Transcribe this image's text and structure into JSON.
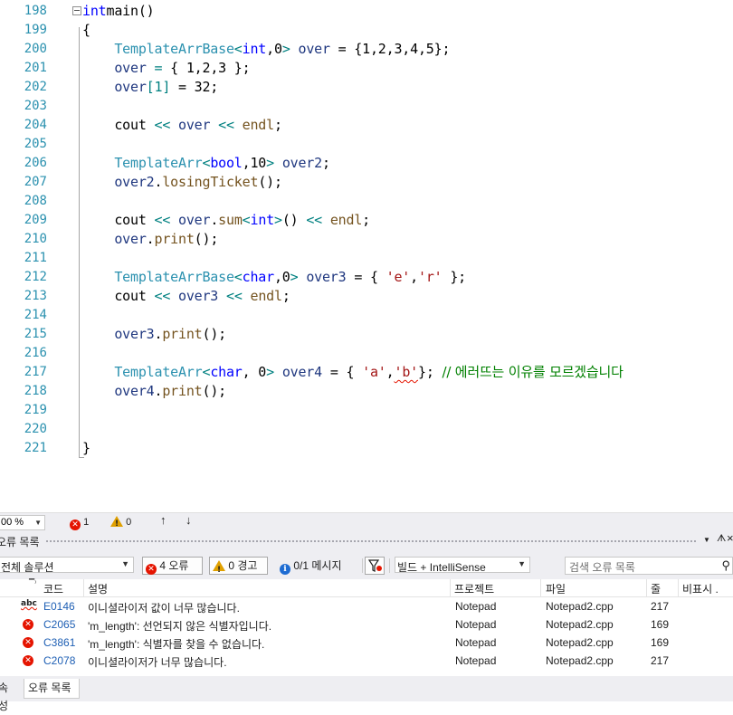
{
  "editor": {
    "lines": [
      {
        "num": "198",
        "tokens": [
          [
            "kw",
            "int"
          ],
          [
            "",
            "main()"
          ]
        ]
      },
      {
        "num": "199",
        "tokens": [
          [
            "",
            "{"
          ]
        ]
      },
      {
        "num": "200",
        "tokens": [
          [
            "",
            "    "
          ],
          [
            "ty",
            "TemplateArrBase"
          ],
          [
            "op",
            "<"
          ],
          [
            "kw",
            "int"
          ],
          [
            "",
            ",0"
          ],
          [
            "op",
            ">"
          ],
          [
            "",
            ""
          ],
          [
            "var",
            " over"
          ],
          [
            "",
            " = {1,2,3,4,5};"
          ]
        ]
      },
      {
        "num": "201",
        "tokens": [
          [
            "",
            "    "
          ],
          [
            "var",
            "over"
          ],
          [
            "op",
            " ="
          ],
          [
            "",
            " { 1,2,3 };"
          ]
        ]
      },
      {
        "num": "202",
        "tokens": [
          [
            "",
            "    "
          ],
          [
            "var",
            "over"
          ],
          [
            "op",
            "[1]"
          ],
          [
            "",
            " = 32;"
          ]
        ]
      },
      {
        "num": "203",
        "tokens": []
      },
      {
        "num": "204",
        "tokens": [
          [
            "",
            "    cout "
          ],
          [
            "op",
            "<<"
          ],
          [
            "var",
            " over"
          ],
          [
            "op",
            " <<"
          ],
          [
            "fn",
            " endl"
          ],
          [
            "",
            ";"
          ]
        ]
      },
      {
        "num": "205",
        "tokens": []
      },
      {
        "num": "206",
        "tokens": [
          [
            "",
            "    "
          ],
          [
            "ty",
            "TemplateArr"
          ],
          [
            "op",
            "<"
          ],
          [
            "kw",
            "bool"
          ],
          [
            "",
            ",10"
          ],
          [
            "op",
            ">"
          ],
          [
            "var",
            " over2"
          ],
          [
            "",
            ";"
          ]
        ]
      },
      {
        "num": "207",
        "tokens": [
          [
            "",
            "    "
          ],
          [
            "var",
            "over2"
          ],
          [
            "",
            "."
          ],
          [
            "fn",
            "losingTicket"
          ],
          [
            "",
            "();"
          ]
        ]
      },
      {
        "num": "208",
        "tokens": []
      },
      {
        "num": "209",
        "tokens": [
          [
            "",
            "    cout "
          ],
          [
            "op",
            "<<"
          ],
          [
            "var",
            " over"
          ],
          [
            "",
            "."
          ],
          [
            "fn",
            "sum"
          ],
          [
            "op",
            "<"
          ],
          [
            "kw",
            "int"
          ],
          [
            "op",
            ">"
          ],
          [
            "",
            "() "
          ],
          [
            "op",
            "<<"
          ],
          [
            "fn",
            " endl"
          ],
          [
            "",
            ";"
          ]
        ]
      },
      {
        "num": "210",
        "tokens": [
          [
            "",
            "    "
          ],
          [
            "var",
            "over"
          ],
          [
            "",
            "."
          ],
          [
            "fn",
            "print"
          ],
          [
            "",
            "();"
          ]
        ]
      },
      {
        "num": "211",
        "tokens": []
      },
      {
        "num": "212",
        "tokens": [
          [
            "",
            "    "
          ],
          [
            "ty",
            "TemplateArrBase"
          ],
          [
            "op",
            "<"
          ],
          [
            "kw",
            "char"
          ],
          [
            "",
            ",0"
          ],
          [
            "op",
            ">"
          ],
          [
            "var",
            " over3"
          ],
          [
            "",
            " = { "
          ],
          [
            "str",
            "'e'"
          ],
          [
            "",
            ","
          ],
          [
            "str",
            "'r'"
          ],
          [
            "",
            " };"
          ]
        ]
      },
      {
        "num": "213",
        "tokens": [
          [
            "",
            "    cout "
          ],
          [
            "op",
            "<<"
          ],
          [
            "var",
            " over3"
          ],
          [
            "op",
            " <<"
          ],
          [
            "fn",
            " endl"
          ],
          [
            "",
            ";"
          ]
        ]
      },
      {
        "num": "214",
        "tokens": []
      },
      {
        "num": "215",
        "tokens": [
          [
            "",
            "    "
          ],
          [
            "var",
            "over3"
          ],
          [
            "",
            "."
          ],
          [
            "fn",
            "print"
          ],
          [
            "",
            "();"
          ]
        ]
      },
      {
        "num": "216",
        "tokens": []
      },
      {
        "num": "217",
        "tokens": [
          [
            "",
            "    "
          ],
          [
            "ty",
            "TemplateArr"
          ],
          [
            "op",
            "<"
          ],
          [
            "kw",
            "char"
          ],
          [
            "",
            ", 0"
          ],
          [
            "op",
            ">"
          ],
          [
            "var",
            " over4"
          ],
          [
            "",
            " = { "
          ],
          [
            "str",
            "'a'"
          ],
          [
            "",
            ","
          ],
          [
            "str squig",
            "'b'"
          ],
          [
            "",
            "}; "
          ],
          [
            "cm",
            "// 에러뜨는 이유를 모르겠습니다"
          ]
        ]
      },
      {
        "num": "218",
        "tokens": [
          [
            "",
            "    "
          ],
          [
            "var",
            "over4"
          ],
          [
            "",
            "."
          ],
          [
            "fn",
            "print"
          ],
          [
            "",
            "();"
          ]
        ]
      },
      {
        "num": "219",
        "tokens": []
      },
      {
        "num": "220",
        "tokens": []
      },
      {
        "num": "221",
        "tokens": [
          [
            "",
            "}"
          ]
        ]
      }
    ]
  },
  "status": {
    "zoom": "00 %",
    "error_count": "1",
    "warning_count": "0",
    "up_arrow": "↑",
    "down_arrow": "↓"
  },
  "error_list": {
    "title": "오류 목록",
    "pin": "ᗑ",
    "close": "×",
    "scope": "전체 솔루션",
    "errors_btn": "4 오류",
    "warnings_btn": "0 경고",
    "messages_btn": "0/1 메시지",
    "build_filter": "빌드 + IntelliSense",
    "search_placeholder": "검색 오류 목록",
    "columns": {
      "code": "코드",
      "description": "설명",
      "project": "프로젝트",
      "file": "파일",
      "line": "줄",
      "suppression": "비표시 ."
    },
    "rows": [
      {
        "icon": "intellisense",
        "code": "E0146",
        "description": "이니셜라이저 값이 너무 많습니다.",
        "project": "Notepad",
        "file": "Notepad2.cpp",
        "line": "217"
      },
      {
        "icon": "error",
        "code": "C2065",
        "description": "'m_length': 선언되지 않은 식별자입니다.",
        "project": "Notepad",
        "file": "Notepad2.cpp",
        "line": "169"
      },
      {
        "icon": "error",
        "code": "C3861",
        "description": "'m_length': 식별자를 찾을 수 없습니다.",
        "project": "Notepad",
        "file": "Notepad2.cpp",
        "line": "169"
      },
      {
        "icon": "error",
        "code": "C2078",
        "description": "이니셜라이저가 너무 많습니다.",
        "project": "Notepad",
        "file": "Notepad2.cpp",
        "line": "217"
      }
    ]
  },
  "tabs": [
    "속성",
    "오류 목록"
  ],
  "colors": {
    "line_number": "#2b91af",
    "keyword": "#0000ff",
    "type": "#2b91af",
    "string": "#a31515",
    "comment": "#008000",
    "error_red": "#e51400",
    "panel_bg": "#eeeef2"
  }
}
